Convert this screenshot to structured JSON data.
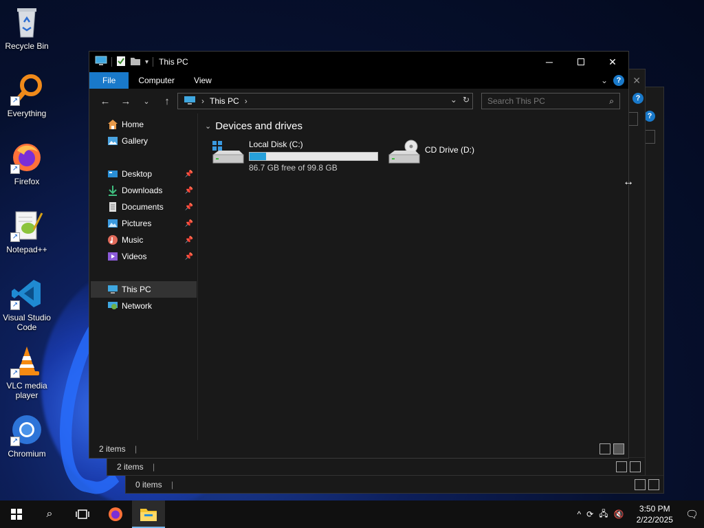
{
  "desktop": {
    "icons": [
      {
        "label": "Recycle Bin"
      },
      {
        "label": "Everything"
      },
      {
        "label": "Firefox"
      },
      {
        "label": "Notepad++"
      },
      {
        "label": "Visual Studio Code"
      },
      {
        "label": "VLC media player"
      },
      {
        "label": "Chromium"
      }
    ]
  },
  "background_windows": [
    {
      "status_text": "2 items"
    },
    {
      "status_text": "0 items"
    }
  ],
  "explorer": {
    "title": "This PC",
    "ribbon_tabs": [
      {
        "label": "File"
      },
      {
        "label": "Computer"
      },
      {
        "label": "View"
      }
    ],
    "help_label": "?",
    "address": {
      "crumb": "This PC"
    },
    "search": {
      "placeholder": "Search This PC"
    },
    "sidebar": {
      "quick": [
        {
          "label": "Home",
          "pinned": false
        },
        {
          "label": "Gallery",
          "pinned": false
        }
      ],
      "pinned": [
        {
          "label": "Desktop"
        },
        {
          "label": "Downloads"
        },
        {
          "label": "Documents"
        },
        {
          "label": "Pictures"
        },
        {
          "label": "Music"
        },
        {
          "label": "Videos"
        }
      ],
      "locations": [
        {
          "label": "This PC",
          "selected": true
        },
        {
          "label": "Network",
          "selected": false
        }
      ]
    },
    "group_title": "Devices and drives",
    "drives": [
      {
        "name": "Local Disk (C:)",
        "free_text": "86.7 GB free of 99.8 GB",
        "used_fraction": 0.131
      },
      {
        "name": "CD Drive (D:)"
      }
    ],
    "status_text": "2 items"
  },
  "taskbar": {
    "time": "3:50 PM",
    "date": "2/22/2025"
  },
  "colors": {
    "accent": "#1979ca",
    "progress": "#26a0da"
  }
}
